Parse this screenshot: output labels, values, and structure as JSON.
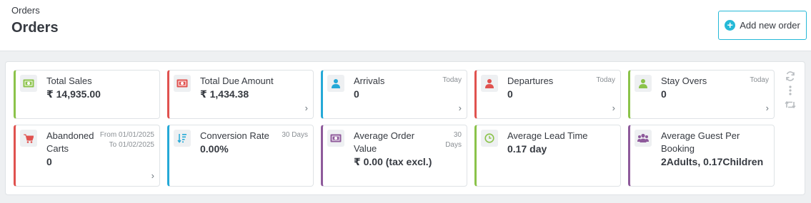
{
  "header": {
    "breadcrumb": "Orders",
    "title": "Orders",
    "add_button_label": "Add new order"
  },
  "kpis_row1": [
    {
      "label": "Total Sales",
      "value": "₹ 14,935.00",
      "period": "",
      "icon": "money-icon",
      "color": "#8bc34a"
    },
    {
      "label": "Total Due Amount",
      "value": "₹ 1,434.38",
      "period": "",
      "icon": "money-icon",
      "color": "#e0524f"
    },
    {
      "label": "Arrivals",
      "value": "0",
      "period": "Today",
      "icon": "user-icon",
      "color": "#25a9d7"
    },
    {
      "label": "Departures",
      "value": "0",
      "period": "Today",
      "icon": "user-icon",
      "color": "#e0524f"
    },
    {
      "label": "Stay Overs",
      "value": "0",
      "period": "Today",
      "icon": "user-icon",
      "color": "#8bc34a"
    }
  ],
  "kpis_row2": [
    {
      "label_line1": "Abandoned",
      "label_line2": "Carts",
      "value": "0",
      "period_line1": "From 01/01/2025",
      "period_line2": "To 01/02/2025",
      "icon": "cart-icon",
      "color": "#e0524f"
    },
    {
      "label": "Conversion Rate",
      "value": "0.00%",
      "period": "30 Days",
      "icon": "sort-icon",
      "color": "#25a9d7"
    },
    {
      "label_line1": "Average Order",
      "label_line2": "Value",
      "value": "₹ 0.00 (tax excl.)",
      "period_line1": "30",
      "period_line2": "Days",
      "icon": "money-icon",
      "color": "#8e5a9b"
    },
    {
      "label": "Average Lead Time",
      "value": "0.17 day",
      "icon": "clock-icon",
      "color": "#8bc34a"
    },
    {
      "label_line1": "Average Guest Per",
      "label_line2": "Booking",
      "value": "2Adults, 0.17Children",
      "icon": "users-icon",
      "color": "#8e5a9b"
    }
  ],
  "chevron": "›"
}
